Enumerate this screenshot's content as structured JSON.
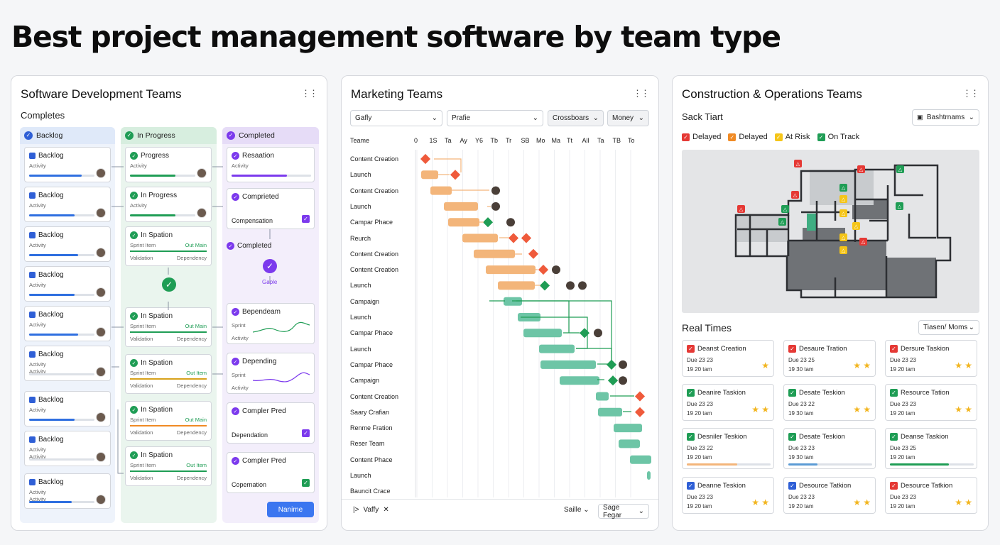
{
  "page_title": "Best project management software by team type",
  "software": {
    "title": "Software Development Teams",
    "subtitle": "Completes",
    "columns": [
      {
        "label": "Backlog",
        "color": "#2f5fd6"
      },
      {
        "label": "In Progress",
        "color": "#1f9d55"
      },
      {
        "label": "Completed",
        "color": "#7c3aed"
      }
    ],
    "backlog_cards": [
      {
        "title": "Backlog",
        "sub": "Activity",
        "progress": 0.8
      },
      {
        "title": "Backlog",
        "sub": "Activity",
        "progress": 0.7
      },
      {
        "title": "Backlog",
        "sub": "Activity",
        "progress": 0.75
      },
      {
        "title": "Backlog",
        "sub": "Activity",
        "progress": 0.7
      },
      {
        "title": "Backlog",
        "sub": "Activity",
        "progress": 0.75
      },
      {
        "title": "Backlog",
        "sub": "Activity",
        "sub2": "Activity",
        "progress": 0.0
      },
      {
        "title": "Backlog",
        "sub": "Activity",
        "progress": 0.7
      },
      {
        "title": "Backlog",
        "sub": "Activity",
        "sub2": "Activity",
        "progress": 0.0
      },
      {
        "title": "Backlog",
        "sub": "Activity",
        "sub2": "Activity",
        "progress": 0.65
      }
    ],
    "progress_cards": [
      {
        "title": "Progress",
        "sub": "Activity"
      },
      {
        "title": "In Progress",
        "sub": "Activity"
      },
      {
        "title": "In Spation",
        "l1": "Sprint Item",
        "r1": "Out Main",
        "l2": "Validation",
        "r2": "Dependency"
      },
      {
        "title": "In Spation",
        "l1": "Sprint Item",
        "r1": "Out Main",
        "l2": "Validation",
        "r2": "Dependency"
      },
      {
        "title": "In Spation",
        "l1": "Sprint Item",
        "r1": "Out Item",
        "l2": "Validation",
        "r2": "Dependency"
      },
      {
        "title": "In Spation",
        "l1": "Sprint Item",
        "r1": "Out Main",
        "l2": "Validation",
        "r2": "Dependency"
      },
      {
        "title": "In Spation",
        "l1": "Sprint Item",
        "r1": "Out Item",
        "l2": "Validation",
        "r2": "Dependency"
      }
    ],
    "completed_cards": [
      {
        "title": "Resaation",
        "sub": "Activity"
      },
      {
        "title": "Comprieted",
        "sub": "Compensation"
      },
      {
        "title": "Completed",
        "sub": "Gaple"
      },
      {
        "title": "Bependeam",
        "sub": "Sprint",
        "sub2": "Activity"
      },
      {
        "title": "Depending",
        "sub": "Sprint",
        "sub2": "Activity"
      },
      {
        "title": "Compler Pred",
        "sub": "Dependation"
      },
      {
        "title": "Compler Pred",
        "sub": "Copernation"
      }
    ],
    "button_label": "Nanime"
  },
  "marketing": {
    "title": "Marketing Teams",
    "filters": [
      "Gafly",
      "Prafie",
      "Crossboars",
      "Money"
    ],
    "header_label": "Teame",
    "date_ticks": [
      "0",
      "1S",
      "Ta",
      "Ay",
      "Y6",
      "Tb",
      "Tr",
      "SB",
      "Mo",
      "Ma",
      "Tt",
      "All",
      "Ta",
      "TB",
      "To"
    ],
    "rows": [
      "Content Creation",
      "Launch",
      "Content Creation",
      "Launch",
      "Campar Phace",
      "Reurch",
      "Content Creation",
      "Content Creation",
      "Launch",
      "Campaign",
      "Launch",
      "Campar Phace",
      "Launch",
      "Campar Phace",
      "Campaign",
      "Content Creation",
      "Saary Crafian",
      "Renme Fration",
      "Reser Team",
      "Content Phace",
      "Launch",
      "Bauncit Crace"
    ],
    "footer_left": "Vaffy",
    "footer_mid": "Saille",
    "footer_right": "Sage Fegar",
    "colors": {
      "orange": "#f3b57a",
      "green": "#6dc5a6",
      "red": "#ef5a3b"
    }
  },
  "construction": {
    "title": "Construction & Operations Teams",
    "subtitle": "Sack Tiart",
    "dropdown": "Bashtrnams",
    "legend": [
      {
        "label": "Delayed",
        "color": "#e53935"
      },
      {
        "label": "Delayed",
        "color": "#f08a24"
      },
      {
        "label": "At Risk",
        "color": "#f5c518"
      },
      {
        "label": "On Track",
        "color": "#1f9d55"
      }
    ],
    "section": "Real Times",
    "section_dropdown": "Tiasen/ Moms",
    "cards": [
      {
        "title": "Deanst Creation",
        "date": "Due 23 23",
        "time": "19 20 tam",
        "color": "#e53935",
        "stars": 1
      },
      {
        "title": "Desaure Tration",
        "date": "Due 23 25",
        "time": "19 30 tam",
        "color": "#e53935",
        "stars": 2
      },
      {
        "title": "Dersure Taskion",
        "date": "Due 23 23",
        "time": "19 20 tam",
        "color": "#e53935",
        "stars": 2
      },
      {
        "title": "Deanire Taskion",
        "date": "Due 23 23",
        "time": "19 20 tam",
        "color": "#1f9d55",
        "stars": 2
      },
      {
        "title": "Desate Teskion",
        "date": "Due 23 22",
        "time": "19 30 tam",
        "color": "#1f9d55",
        "stars": 2
      },
      {
        "title": "Resource Tation",
        "date": "Due 23 23",
        "time": "19 20 tam",
        "color": "#1f9d55",
        "stars": 2
      },
      {
        "title": "Desniler Teskion",
        "date": "Due 23 22",
        "time": "19 20 tam",
        "color": "#1f9d55",
        "stars": 0,
        "progress": 0.6,
        "bar": "#f3b57a"
      },
      {
        "title": "Desate Teskion",
        "date": "Due 23 23",
        "time": "19 30 tam",
        "color": "#1f9d55",
        "stars": 0,
        "progress": 0.35,
        "bar": "#5b9bd5"
      },
      {
        "title": "Deanse Taskion",
        "date": "Due 23 25",
        "time": "19 20 tam",
        "color": "#1f9d55",
        "stars": 0,
        "progress": 0.7,
        "bar": "#1f9d55"
      },
      {
        "title": "Deanne Teskion",
        "date": "Due 23 23",
        "time": "19 20 tam",
        "color": "#2f5fd6",
        "stars": 2
      },
      {
        "title": "Desource Tatkion",
        "date": "Due 23 23",
        "time": "19 20 tam",
        "color": "#2f5fd6",
        "stars": 2
      },
      {
        "title": "Desource Tatkion",
        "date": "Due 23 23",
        "time": "19 20 tam",
        "color": "#e53935",
        "stars": 2
      }
    ]
  }
}
